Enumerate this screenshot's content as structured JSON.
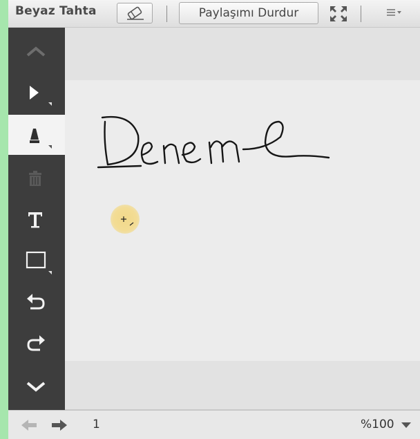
{
  "header": {
    "title": "Beyaz Tahta",
    "stop_sharing_label": "Paylaşımı Durdur",
    "eraser_icon": "eraser-icon",
    "fullscreen_icon": "fullscreen-icon",
    "menu_icon": "menu-icon"
  },
  "toolbar": {
    "tools": [
      {
        "name": "scroll-up",
        "icon": "chevron-up-icon"
      },
      {
        "name": "select",
        "icon": "pointer-arrow-icon"
      },
      {
        "name": "pen",
        "icon": "pen-icon",
        "active": true
      },
      {
        "name": "delete",
        "icon": "trash-icon",
        "disabled": true
      },
      {
        "name": "text",
        "icon": "text-icon",
        "label": "T"
      },
      {
        "name": "shape",
        "icon": "rectangle-icon"
      },
      {
        "name": "undo",
        "icon": "undo-icon"
      },
      {
        "name": "redo",
        "icon": "redo-icon"
      },
      {
        "name": "scroll-down",
        "icon": "chevron-down-icon"
      }
    ]
  },
  "canvas": {
    "handwritten_text": "Deneme",
    "cursor": "crosshair-pen-cursor"
  },
  "footer": {
    "page_number": "1",
    "zoom": "%100",
    "prev_icon": "arrow-left-icon",
    "next_icon": "arrow-right-icon",
    "zoom_dropdown_icon": "caret-down-icon"
  }
}
